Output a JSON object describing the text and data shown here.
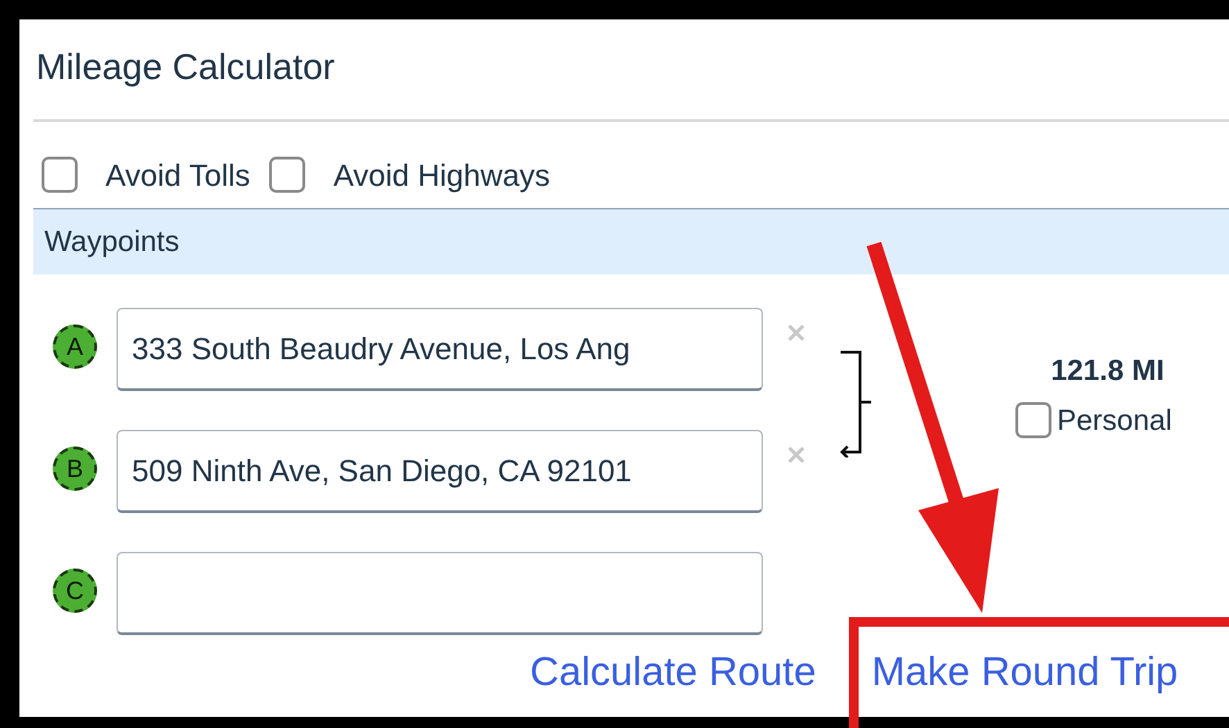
{
  "panel": {
    "title": "Mileage Calculator"
  },
  "options": [
    {
      "label": "Avoid Tolls",
      "checked": false
    },
    {
      "label": "Avoid Highways",
      "checked": false
    }
  ],
  "section": {
    "title": "Waypoints"
  },
  "waypoints": [
    {
      "marker": "A",
      "value": "333 South Beaudry Avenue, Los Ang"
    },
    {
      "marker": "B",
      "value": "509 Ninth Ave, San Diego, CA 92101"
    },
    {
      "marker": "C"
    }
  ],
  "legs": [
    {
      "distance": "121.8 MI",
      "personal_label": "Personal",
      "personal": false
    }
  ],
  "links": [
    "Calculate Route",
    "Make Round Trip"
  ]
}
